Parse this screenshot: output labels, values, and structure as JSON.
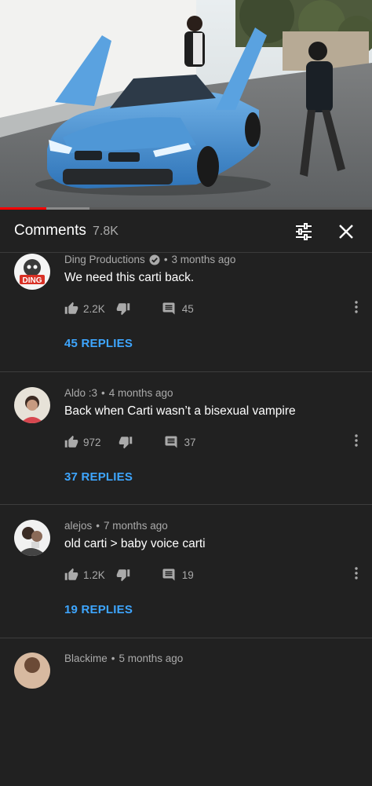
{
  "video": {
    "progress_fraction": 0.125,
    "buffered_fraction": 0.24,
    "colors": {
      "played": "#ff0000",
      "buffered": "#8a8a8a",
      "track": "#5a5a5a"
    }
  },
  "header": {
    "title": "Comments",
    "count": "7.8K",
    "filter_icon": "sort-sliders-icon",
    "close_icon": "close-icon"
  },
  "comments": [
    {
      "author": "Ding Productions",
      "verified": true,
      "time": "3 months ago",
      "text": "We need this carti back.",
      "likes": "2.2K",
      "reply_count": "45",
      "replies_label": "45 REPLIES"
    },
    {
      "author": "Aldo :3",
      "verified": false,
      "time": "4 months ago",
      "text": "Back when Carti wasn’t a bisexual vampire",
      "likes": "972",
      "reply_count": "37",
      "replies_label": "37 REPLIES"
    },
    {
      "author": "alejos",
      "verified": false,
      "time": "7 months ago",
      "text": "old carti > baby voice carti",
      "likes": "1.2K",
      "reply_count": "19",
      "replies_label": "19 REPLIES"
    },
    {
      "author": "Blackime",
      "verified": false,
      "time": "5 months ago",
      "text": "",
      "likes": "",
      "reply_count": "",
      "replies_label": ""
    }
  ],
  "accent": {
    "link": "#3ea6ff",
    "background": "#212121"
  }
}
